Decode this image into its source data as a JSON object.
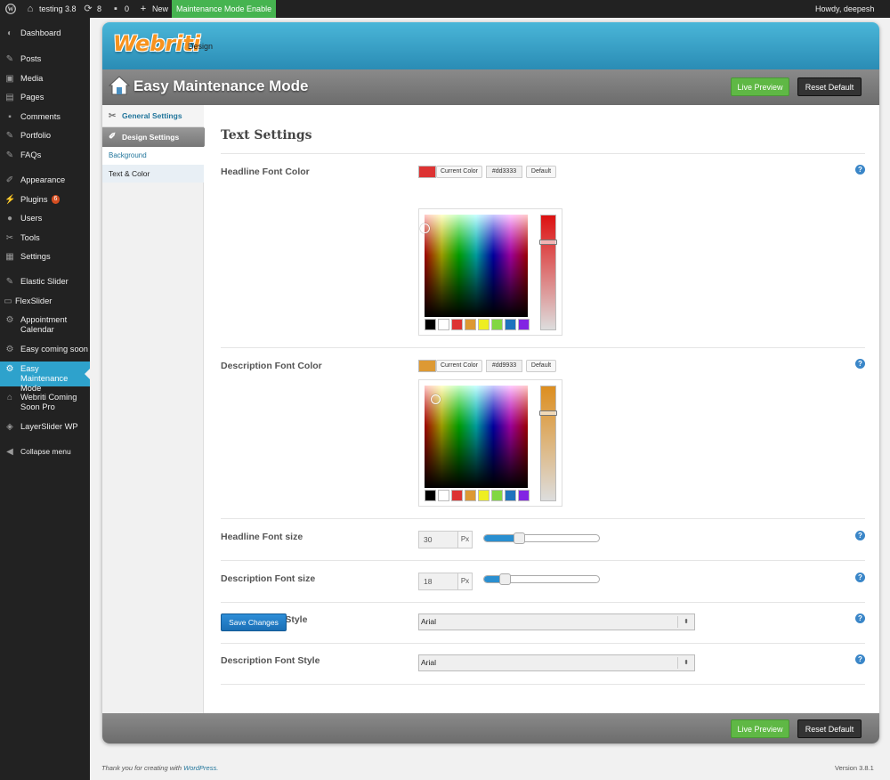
{
  "admin_bar": {
    "site_name": "testing 3.8",
    "updates_count": "8",
    "comments_count": "0",
    "new_label": "New",
    "maintenance_label": "Maintenance Mode Enable",
    "greeting": "Howdy, deepesh"
  },
  "sidebar": {
    "items": [
      {
        "label": "Dashboard",
        "icon": "dashboard-icon"
      },
      {
        "label": "Posts",
        "icon": "pin-icon"
      },
      {
        "label": "Media",
        "icon": "media-icon"
      },
      {
        "label": "Pages",
        "icon": "page-icon"
      },
      {
        "label": "Comments",
        "icon": "comment-icon"
      },
      {
        "label": "Portfolio",
        "icon": "pin-icon"
      },
      {
        "label": "FAQs",
        "icon": "pin-icon"
      },
      {
        "label": "Appearance",
        "icon": "brush-icon"
      },
      {
        "label": "Plugins",
        "icon": "plug-icon",
        "badge": "6"
      },
      {
        "label": "Users",
        "icon": "user-icon"
      },
      {
        "label": "Tools",
        "icon": "wrench-icon"
      },
      {
        "label": "Settings",
        "icon": "settings-icon"
      },
      {
        "label": "Elastic Slider",
        "icon": "pin-icon"
      },
      {
        "label": "FlexSlider",
        "icon": "slider-icon"
      },
      {
        "label": "Appointment Calendar",
        "icon": "gear-icon"
      },
      {
        "label": "Easy coming soon",
        "icon": "gear-icon"
      },
      {
        "label": "Easy Maintenance Mode",
        "icon": "gear-icon"
      },
      {
        "label": "Webriti Coming Soon Pro",
        "icon": "house-icon"
      },
      {
        "label": "LayerSlider WP",
        "icon": "layers-icon"
      },
      {
        "label": "Collapse menu",
        "icon": "collapse-icon"
      }
    ]
  },
  "plugin": {
    "logo_text": "Webriti",
    "logo_sub": "Design",
    "title": "Easy Maintenance Mode",
    "live_preview": "Live Preview",
    "reset_default": "Reset Default"
  },
  "subnav": {
    "general": "General Settings",
    "design": "Design Settings",
    "background": "Background",
    "text_color": "Text & Color"
  },
  "text_settings": {
    "title": "Text Settings",
    "headline_color": {
      "label": "Headline Font Color",
      "current_color_label": "Current Color",
      "hex": "#dd3333",
      "default_label": "Default",
      "swatch_color": "#dd3333"
    },
    "description_color": {
      "label": "Description Font Color",
      "current_color_label": "Current Color",
      "hex": "#dd9933",
      "default_label": "Default",
      "swatch_color": "#dd9933"
    },
    "palette": [
      "#000000",
      "#ffffff",
      "#dd3333",
      "#dd9933",
      "#eeee22",
      "#81d742",
      "#1e73be",
      "#8224e3"
    ],
    "headline_size": {
      "label": "Headline Font size",
      "value": "30",
      "unit": "Px",
      "fraction": 0.3
    },
    "description_size": {
      "label": "Description Font size",
      "value": "18",
      "unit": "Px",
      "fraction": 0.18
    },
    "headline_style": {
      "label": "Headline Font Style",
      "value": "Arial"
    },
    "description_style": {
      "label": "Description Font Style",
      "value": "Arial"
    },
    "help_symbol": "?",
    "save_label": "Save Changes"
  },
  "footer": {
    "thanks": "Thank you for creating with",
    "wp_link": "WordPress.",
    "version": "Version 3.8.1"
  }
}
